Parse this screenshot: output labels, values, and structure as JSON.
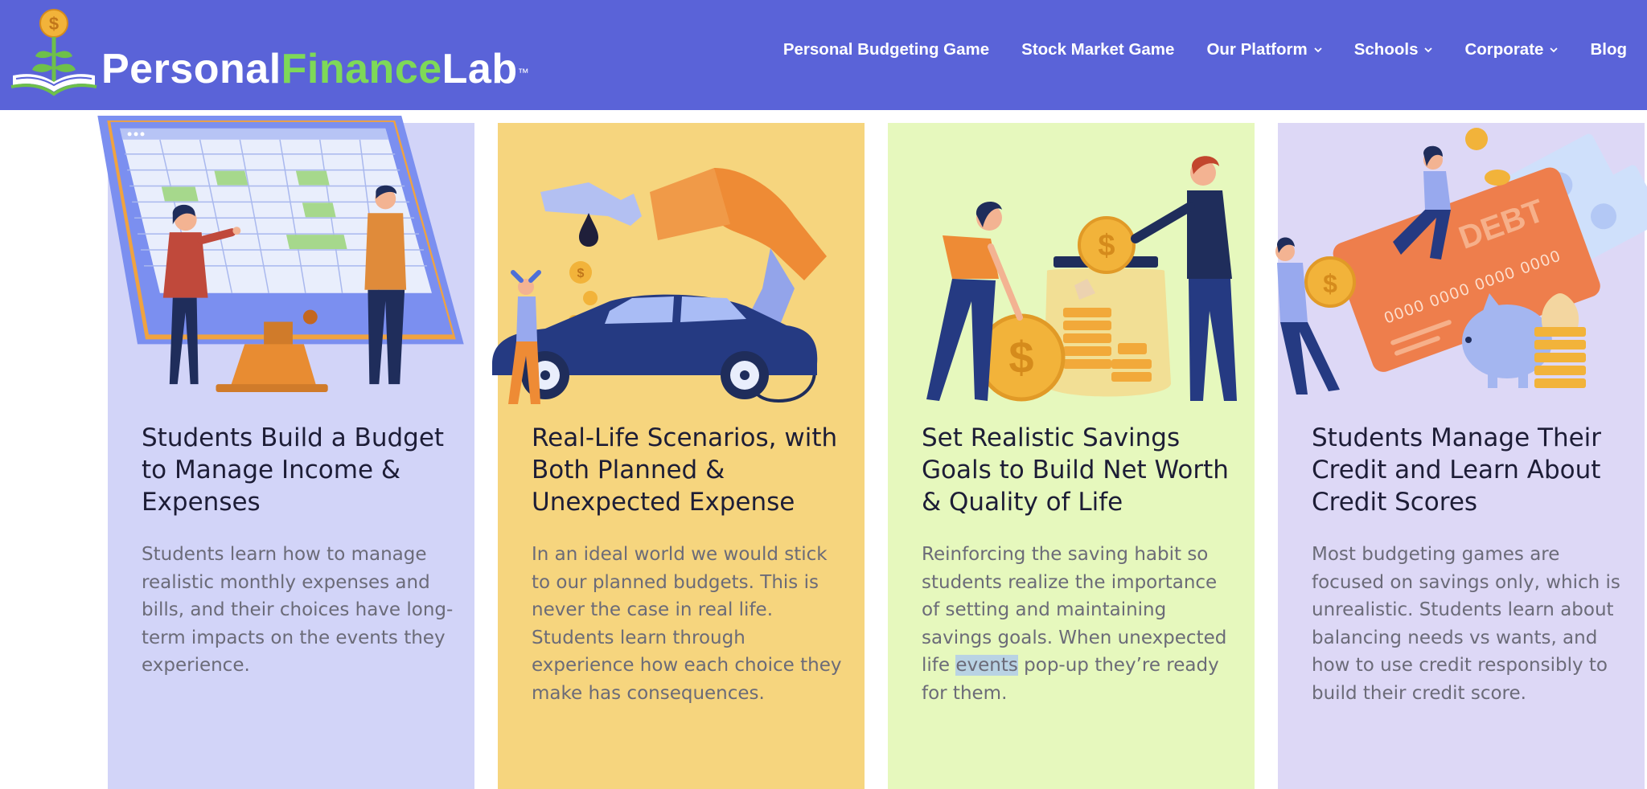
{
  "header": {
    "logo": {
      "part1": "Personal",
      "part2": "Finance",
      "part3": "Lab",
      "trademark": "™"
    },
    "nav": [
      {
        "label": "Personal Budgeting Game",
        "dropdown": false
      },
      {
        "label": "Stock Market Game",
        "dropdown": false
      },
      {
        "label": "Our Platform",
        "dropdown": true
      },
      {
        "label": "Schools",
        "dropdown": true
      },
      {
        "label": "Corporate",
        "dropdown": true
      },
      {
        "label": "Blog",
        "dropdown": false
      }
    ]
  },
  "colors": {
    "header_bg": "#5a63d8",
    "logo_green": "#7ed957",
    "card1_bg": "#d2d4f8",
    "card2_bg": "#f6d57e",
    "card3_bg": "#e6f8bd",
    "card4_bg": "#ddd8f6"
  },
  "cards": [
    {
      "title": "Students Build a Budget to Manage Income & Expenses",
      "body": "Students learn how to manage realistic monthly expenses and bills, and their choices have long-term impacts on the events they experience.",
      "illustration": "budget-spreadsheet-illustration"
    },
    {
      "title": "Real-Life Scenarios, with Both Planned & Unexpected Expense",
      "body": "In an ideal world we would stick to our planned budgets. This is never the case in real life. Students learn through experience how each choice they make has consequences.",
      "illustration": "fuel-pump-car-illustration"
    },
    {
      "title": "Set Realistic Savings Goals to Build Net Worth & Quality of Life",
      "body_before": "Reinforcing the saving habit so students realize the importance of setting and maintaining savings goals. When unexpected life ",
      "body_highlight": "events",
      "body_after": " pop-up they’re ready for them.",
      "illustration": "savings-jar-coins-illustration"
    },
    {
      "title": "Students Manage Their Credit and Learn About Credit Scores",
      "body": "Most budgeting games are focused on savings only, which is unrealistic. Students learn about balancing needs vs wants, and how to use credit responsibly to build their credit score.",
      "illustration": "debt-credit-card-illustration",
      "card_text": {
        "debt": "DEBT",
        "number": "0000 0000 0000 0000"
      }
    }
  ]
}
